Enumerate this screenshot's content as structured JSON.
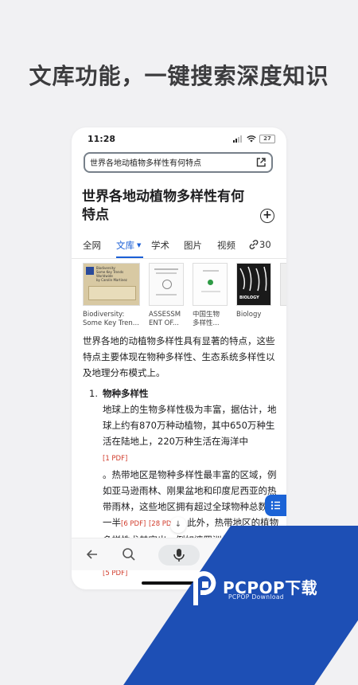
{
  "headline": "文库功能，一键搜索深度知识",
  "status": {
    "time": "11:28",
    "battery": "27"
  },
  "search": {
    "value": "世界各地动植物多样性有何特点"
  },
  "result_title": "世界各地动植物多样性有何特点",
  "tabs": [
    {
      "label": "全网"
    },
    {
      "label": "文库"
    },
    {
      "label": "学术"
    },
    {
      "label": "图片"
    },
    {
      "label": "视频"
    },
    {
      "label": "30"
    }
  ],
  "cards": [
    {
      "caption": "Biodiversity: Some Key Tren...",
      "thumb_lines": [
        "Biodiversity:",
        "Some Key Trends Worldwide",
        "by Carolin Martinez"
      ]
    },
    {
      "caption": "ASSESSM ENT OF..."
    },
    {
      "caption": "中国生物 多样性..."
    },
    {
      "caption": "Biology",
      "thumb_text": "BIOLOGY"
    }
  ],
  "intro": "世界各地的动植物多样性具有显著的特点，这些特点主要体现在物种多样性、生态系统多样性以及地理分布模式上。",
  "section": {
    "number": "1.",
    "heading": "物种多样性",
    "p1": "地球上的生物多样性极为丰富，据估计，地球上约有870万种动植物，其中650万种生活在陆地上，220万种生活在海洋中",
    "cite1": "[1 PDF]",
    "p2": "。热带地区是物种多样性最丰富的区域，例如亚马逊雨林、刚果盆地和印度尼西亚的热带雨林，这些地区拥有超过全球物种总数的一半",
    "cite2": "[6 PDF]",
    "cite3": "[28 PDF]",
    "p3": "。此外，热带地区的植物多样性尤其突出，例如婆罗洲低地生态区的植物物种数量高达10,000种",
    "cite4": "[5 PDF]",
    "p4": "。"
  },
  "watermark": {
    "name": "PCPOP下载",
    "sub": "PCPOP Download"
  },
  "colors": {
    "accent": "#1b5fd6",
    "citation": "#d13b2b",
    "brand": "#1d4fb5"
  }
}
